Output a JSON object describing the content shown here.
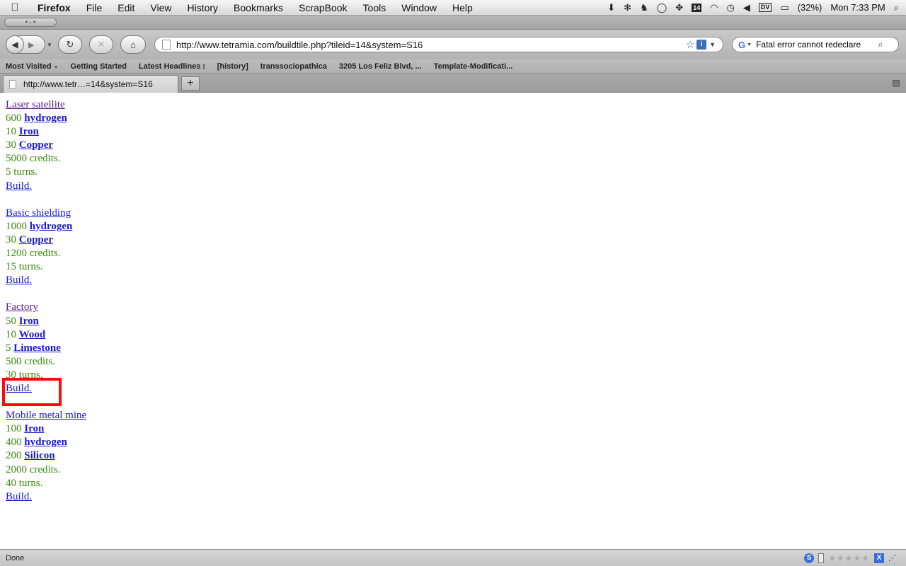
{
  "menubar": {
    "apple": "",
    "app": "Firefox",
    "items": [
      "File",
      "Edit",
      "View",
      "History",
      "Bookmarks",
      "ScrapBook",
      "Tools",
      "Window",
      "Help"
    ],
    "calendar_day": "14",
    "dv": "DV",
    "battery": "(32%)",
    "clock": "Mon 7:33 PM"
  },
  "window": {
    "pill_glyphs": "• - •"
  },
  "toolbar": {
    "url": "http://www.tetramia.com/buildtile.php?tileid=14&system=S16",
    "search_value": "Fatal error cannot redeclare",
    "search_engine": "G"
  },
  "bookmarks": [
    "Most Visited",
    "Getting Started",
    "Latest Headlines",
    "[history]",
    "transsociopathica",
    "3205 Los Feliz Blvd, ...",
    "Template-Modificati..."
  ],
  "tab": {
    "title": "http://www.tetr…=14&system=S16",
    "new_tab": "+"
  },
  "content": {
    "items": [
      {
        "name": "Laser satellite",
        "visited": true,
        "resources": [
          {
            "qty": "600",
            "res": "hydrogen"
          },
          {
            "qty": "10",
            "res": "Iron"
          },
          {
            "qty": "30",
            "res": "Copper"
          }
        ],
        "credits": "5000 credits.",
        "turns": "5 turns.",
        "build": "Build."
      },
      {
        "name": "Basic shielding",
        "visited": false,
        "resources": [
          {
            "qty": "1000",
            "res": "hydrogen"
          },
          {
            "qty": "30",
            "res": "Copper"
          }
        ],
        "credits": "1200 credits.",
        "turns": "15 turns.",
        "build": "Build."
      },
      {
        "name": "Factory",
        "visited": true,
        "resources": [
          {
            "qty": "50",
            "res": "Iron"
          },
          {
            "qty": "10",
            "res": "Wood"
          },
          {
            "qty": "5",
            "res": "Limestone"
          }
        ],
        "credits": "500 credits.",
        "turns": "30 turns.",
        "build": "Build."
      },
      {
        "name": "Mobile metal mine",
        "visited": false,
        "resources": [
          {
            "qty": "100",
            "res": "Iron"
          },
          {
            "qty": "400",
            "res": "hydrogen"
          },
          {
            "qty": "200",
            "res": "Silicon"
          }
        ],
        "credits": "2000 credits.",
        "turns": "40 turns.",
        "build": "Build."
      }
    ]
  },
  "status": {
    "text": "Done",
    "s_icon": "S",
    "stars": "★★★★★",
    "x_icon": "X"
  },
  "colors": {
    "text_green": "#3a8a0e",
    "link_blue": "#1a1ad6",
    "visited_purple": "#5a1a8a",
    "highlight_red": "#ff0a0a"
  }
}
